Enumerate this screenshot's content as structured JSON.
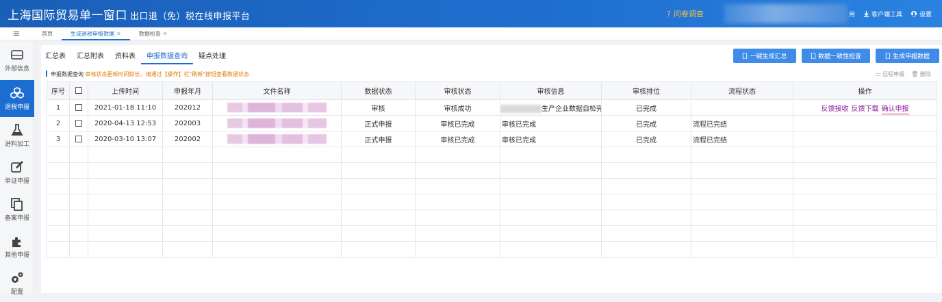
{
  "header": {
    "title": "上海国际贸易单一窗口",
    "subtitle": "出口退（免）税在线申报平台",
    "survey": "问卷调查",
    "links": [
      {
        "label": "用",
        "icon": "user-icon"
      },
      {
        "label": "客户端工具",
        "icon": "download-icon"
      },
      {
        "label": "设置",
        "icon": "gear-icon"
      }
    ]
  },
  "tabs": [
    {
      "label": "首页",
      "closable": false,
      "active": false
    },
    {
      "label": "生成退税申报数据",
      "closable": true,
      "active": true
    },
    {
      "label": "数据检查",
      "closable": true,
      "active": false
    }
  ],
  "sidebar": [
    {
      "label": "外部信息",
      "icon": "drive-icon",
      "active": false
    },
    {
      "label": "退税申报",
      "icon": "cubes-icon",
      "active": true
    },
    {
      "label": "进料加工",
      "icon": "flask-icon",
      "active": false
    },
    {
      "label": "单证申报",
      "icon": "edit-icon",
      "active": false
    },
    {
      "label": "备案申报",
      "icon": "copy-icon",
      "active": false
    },
    {
      "label": "其他申报",
      "icon": "puzzle-icon",
      "active": false
    },
    {
      "label": "配置",
      "icon": "gears-icon",
      "active": false
    }
  ],
  "subtabs": [
    {
      "label": "汇总表",
      "active": false
    },
    {
      "label": "汇总附表",
      "active": false
    },
    {
      "label": "资料表",
      "active": false
    },
    {
      "label": "申报数据查询",
      "active": true
    },
    {
      "label": "疑点处理",
      "active": false
    }
  ],
  "actions": [
    {
      "label": "一键生成汇总",
      "icon": "file-icon"
    },
    {
      "label": "数据一致性检查",
      "icon": "file-icon"
    },
    {
      "label": "生成申报数据",
      "icon": "file-icon"
    }
  ],
  "notice": {
    "title": "申报数据查询",
    "warning": "审核状态更新时间较长，请通过【操作】栏\"刷新\"按钮查看数据状态"
  },
  "tools": {
    "remote": "远程申报",
    "delete": "删除"
  },
  "table": {
    "columns": [
      "序号",
      "",
      "上传时间",
      "申报年月",
      "文件名称",
      "数据状态",
      "审核状态",
      "审核信息",
      "审核排位",
      "流程状态",
      "操作"
    ],
    "rows": [
      {
        "no": "1",
        "upload_time": "2021-01-18 11:10",
        "period": "202012",
        "data_status": "审核",
        "audit_status": "审核成功",
        "audit_info": "生产企业数据自检完",
        "rank": "已完成",
        "flow": "",
        "ops": [
          "反馈接收",
          "反馈下载",
          "确认申报"
        ]
      },
      {
        "no": "2",
        "upload_time": "2020-04-13 12:53",
        "period": "202003",
        "data_status": "正式申报",
        "audit_status": "审核已完成",
        "audit_info": "审核已完成",
        "rank": "已完成",
        "flow": "流程已完结",
        "ops": []
      },
      {
        "no": "3",
        "upload_time": "2020-03-10 13:07",
        "period": "202002",
        "data_status": "正式申报",
        "audit_status": "审核已完成",
        "audit_info": "审核已完成",
        "rank": "已完成",
        "flow": "流程已完结",
        "ops": []
      }
    ],
    "empty_rows": 7
  }
}
